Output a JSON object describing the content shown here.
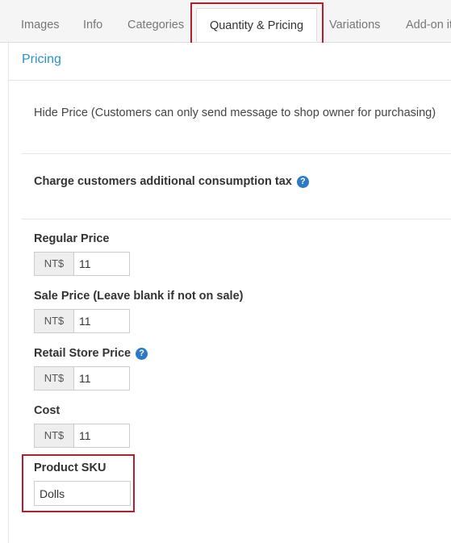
{
  "tabs": [
    {
      "label": "Images"
    },
    {
      "label": "Info"
    },
    {
      "label": "Categories"
    },
    {
      "label": "Quantity & Pricing",
      "active": true
    },
    {
      "label": "Variations"
    },
    {
      "label": "Add-on it"
    }
  ],
  "pricing": {
    "section_title": "Pricing",
    "hide_price_text": "Hide Price (Customers can only send message to shop owner for purchasing)",
    "tax_label": "Charge customers additional consumption tax",
    "help_glyph": "?",
    "currency": "NT$",
    "fields": {
      "regular": {
        "label": "Regular Price",
        "value": "11"
      },
      "sale": {
        "label": "Sale Price (Leave blank if not on sale)",
        "value": "11"
      },
      "retail": {
        "label": "Retail Store Price",
        "value": "11"
      },
      "cost": {
        "label": "Cost",
        "value": "11"
      }
    },
    "sku": {
      "label": "Product SKU",
      "value": "Dolls"
    }
  },
  "colors": {
    "accent": "#2f8fcb",
    "highlight": "#b61e2b",
    "help_icon": "#2f79c2"
  }
}
